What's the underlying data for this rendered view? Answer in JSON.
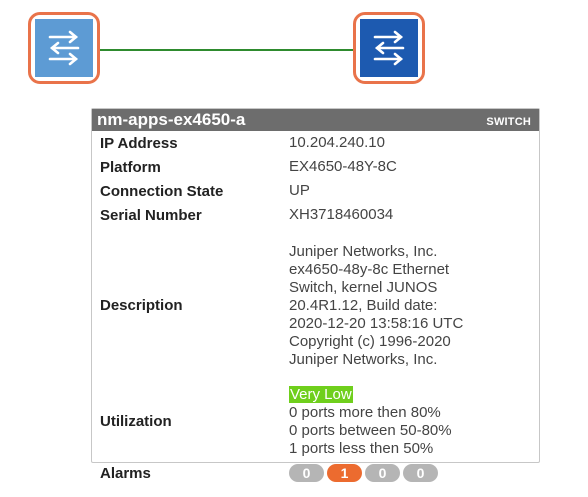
{
  "device": {
    "name": "nm-apps-ex4650-a",
    "type": "SWITCH"
  },
  "fields": {
    "ip_label": "IP Address",
    "ip_value": "10.204.240.10",
    "platform_label": "Platform",
    "platform_value": "EX4650-48Y-8C",
    "connection_label": "Connection State",
    "connection_value": "UP",
    "serial_label": "Serial Number",
    "serial_value": "XH3718460034",
    "description_label": "Description",
    "description_lines": [
      "Juniper Networks, Inc.",
      "ex4650-48y-8c Ethernet",
      "Switch, kernel JUNOS",
      "20.4R1.12, Build date:",
      "2020-12-20 13:58:16 UTC",
      "Copyright (c) 1996-2020",
      "Juniper Networks, Inc."
    ],
    "utilization_label": "Utilization",
    "utilization_level": "Very Low",
    "utilization_lines": [
      "0 ports more then 80%",
      "0 ports between 50-80%",
      "1 ports less then 50%"
    ],
    "alarms_label": "Alarms",
    "alarms": [
      "0",
      "1",
      "0",
      "0"
    ]
  },
  "colors": {
    "node_border": "#e9734a",
    "link": "#2e8b2e",
    "utilization_bg": "#6fcf1c",
    "alarm_active": "#ec6b2f",
    "alarm_inactive": "#b5b5b5"
  },
  "icons": {
    "left_node": "switch-arrows-icon",
    "right_node": "switch-arrows-icon"
  }
}
